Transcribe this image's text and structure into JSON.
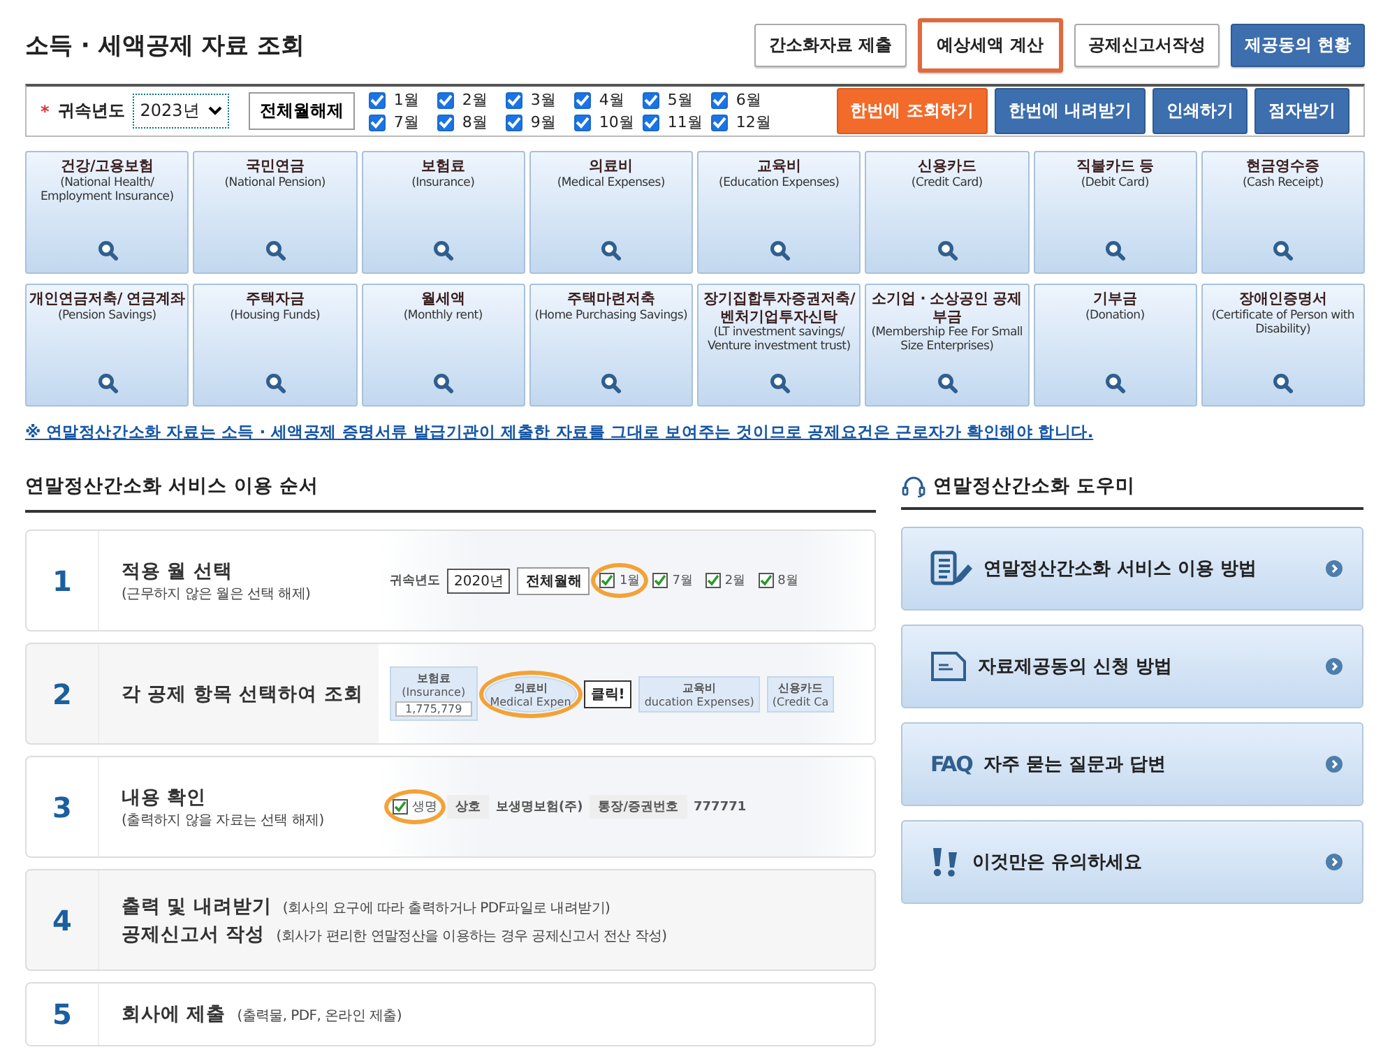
{
  "page_title": "소득 · 세액공제 자료 조회",
  "top_buttons": [
    {
      "label": "간소화자료 제출",
      "kind": "plain",
      "highlighted": false
    },
    {
      "label": "예상세액 계산",
      "kind": "plain",
      "highlighted": true
    },
    {
      "label": "공제신고서작성",
      "kind": "plain",
      "highlighted": false
    },
    {
      "label": "제공동의 현황",
      "kind": "blue",
      "highlighted": false
    }
  ],
  "filter": {
    "required_mark": "*",
    "year_label": "귀속년도",
    "year_value": "2023년",
    "clear_button": "전체월해제",
    "months": [
      {
        "label": "1월",
        "checked": true
      },
      {
        "label": "2월",
        "checked": true
      },
      {
        "label": "3월",
        "checked": true
      },
      {
        "label": "4월",
        "checked": true
      },
      {
        "label": "5월",
        "checked": true
      },
      {
        "label": "6월",
        "checked": true
      },
      {
        "label": "7월",
        "checked": true
      },
      {
        "label": "8월",
        "checked": true
      },
      {
        "label": "9월",
        "checked": true
      },
      {
        "label": "10월",
        "checked": true
      },
      {
        "label": "11월",
        "checked": true
      },
      {
        "label": "12월",
        "checked": true
      }
    ],
    "actions": [
      {
        "label": "한번에 조회하기",
        "kind": "orange"
      },
      {
        "label": "한번에 내려받기",
        "kind": "blue"
      },
      {
        "label": "인쇄하기",
        "kind": "blue"
      },
      {
        "label": "점자받기",
        "kind": "blue"
      }
    ]
  },
  "categories": [
    {
      "title": "건강/고용보험",
      "subtitle": "(National Health/ Employment Insurance)"
    },
    {
      "title": "국민연금",
      "subtitle": "(National Pension)"
    },
    {
      "title": "보험료",
      "subtitle": "(Insurance)"
    },
    {
      "title": "의료비",
      "subtitle": "(Medical Expenses)"
    },
    {
      "title": "교육비",
      "subtitle": "(Education Expenses)"
    },
    {
      "title": "신용카드",
      "subtitle": "(Credit Card)"
    },
    {
      "title": "직불카드 등",
      "subtitle": "(Debit Card)"
    },
    {
      "title": "현금영수증",
      "subtitle": "(Cash Receipt)"
    },
    {
      "title": "개인연금저축/ 연금계좌",
      "subtitle": "(Pension Savings)"
    },
    {
      "title": "주택자금",
      "subtitle": "(Housing Funds)"
    },
    {
      "title": "월세액",
      "subtitle": "(Monthly rent)"
    },
    {
      "title": "주택마련저축",
      "subtitle": "(Home Purchasing Savings)"
    },
    {
      "title": "장기집합투자증권저축/ 벤처기업투자신탁",
      "subtitle": "(LT investment savings/ Venture investment trust)"
    },
    {
      "title": "소기업 · 소상공인 공제부금",
      "subtitle": "(Membership Fee For Small Size Enterprises)"
    },
    {
      "title": "기부금",
      "subtitle": "(Donation)"
    },
    {
      "title": "장애인증명서",
      "subtitle": "(Certificate of Person with Disability)"
    }
  ],
  "notice": "※ 연말정산간소화 자료는 소득 · 세액공제 증명서류 발급기관이 제출한 자료를 그대로 보여주는 것이므로 공제요건은 근로자가 확인해야 합니다.",
  "steps_section": {
    "title": "연말정산간소화 서비스 이용 순서",
    "steps": [
      {
        "number": "1",
        "lines": [
          {
            "title": "적용 월 선택",
            "note": "(근무하지 않은 월은 선택 해제)"
          }
        ],
        "illustration": [
          {
            "kind": "label",
            "text": "귀속년도"
          },
          {
            "kind": "field",
            "text": "2020년"
          },
          {
            "kind": "button",
            "text": "전체월해"
          },
          {
            "kind": "check",
            "text": "1월",
            "highlighted": true
          },
          {
            "kind": "check",
            "text": "7월"
          },
          {
            "kind": "check",
            "text": "2월"
          },
          {
            "kind": "check",
            "text": "8월"
          }
        ]
      },
      {
        "number": "2",
        "lines": [
          {
            "title": "각 공제 항목 선택하여 조회"
          }
        ],
        "illustration": [
          {
            "kind": "tile",
            "text": "보험료",
            "sub": "(Insurance)",
            "value": "1,775,779"
          },
          {
            "kind": "tile",
            "text": "의료비",
            "sub": "Medical Expen",
            "highlighted": true
          },
          {
            "kind": "callout",
            "text": "클릭!"
          },
          {
            "kind": "tile",
            "text": "교육비",
            "sub": "ducation Expenses)"
          },
          {
            "kind": "tile",
            "text": "신용카드",
            "sub": "(Credit Ca"
          }
        ]
      },
      {
        "number": "3",
        "lines": [
          {
            "title": "내용 확인",
            "note": "(출력하지 않을 자료는 선택 해제)"
          }
        ],
        "illustration": [
          {
            "kind": "check",
            "text": "생명",
            "highlighted": true
          },
          {
            "kind": "header",
            "text": "상호"
          },
          {
            "kind": "label",
            "text": "보생명보험(주)"
          },
          {
            "kind": "header",
            "text": "통장/증권번호"
          },
          {
            "kind": "label",
            "text": "777771"
          }
        ]
      },
      {
        "number": "4",
        "lines": [
          {
            "title": "출력 및 내려받기",
            "note": "(회사의 요구에 따라 출력하거나 PDF파일로 내려받기)"
          },
          {
            "title": "공제신고서 작성",
            "note": "(회사가 편리한 연말정산을 이용하는 경우 공제신고서 전산 작성)"
          }
        ]
      },
      {
        "number": "5",
        "lines": [
          {
            "title": "회사에 제출",
            "note": "(출력물, PDF, 온라인 제출)"
          }
        ]
      }
    ]
  },
  "help": {
    "title": "연말정산간소화 도우미",
    "items": [
      {
        "label": "연말정산간소화 서비스 이용 방법",
        "kind": "document"
      },
      {
        "label": "자료제공동의 신청 방법",
        "kind": "memo"
      },
      {
        "label": "자주 묻는 질문과 답변",
        "kind": "faq",
        "icon_text": "FAQ"
      },
      {
        "label": "이것만은 유의하세요",
        "kind": "alert"
      }
    ]
  }
}
